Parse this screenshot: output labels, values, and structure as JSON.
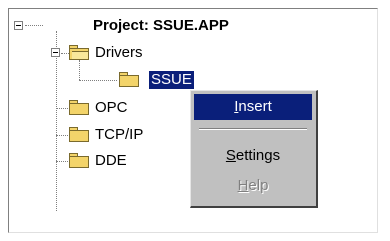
{
  "tree": {
    "project_label": "Project: SSUE.APP",
    "drivers_label": "Drivers",
    "selected_label": "SSUE",
    "items": [
      "OPC",
      "TCP/IP",
      "DDE"
    ]
  },
  "menu": {
    "insert": {
      "prefix": "",
      "accel": "I",
      "rest": "nsert"
    },
    "settings": {
      "prefix": "",
      "accel": "S",
      "rest": "ettings"
    },
    "help": {
      "prefix": "",
      "accel": "H",
      "rest": "elp"
    }
  },
  "colors": {
    "selection": "#0a1f7a",
    "folder": "#f3d46a",
    "menu_bg": "#c0c0c0"
  }
}
